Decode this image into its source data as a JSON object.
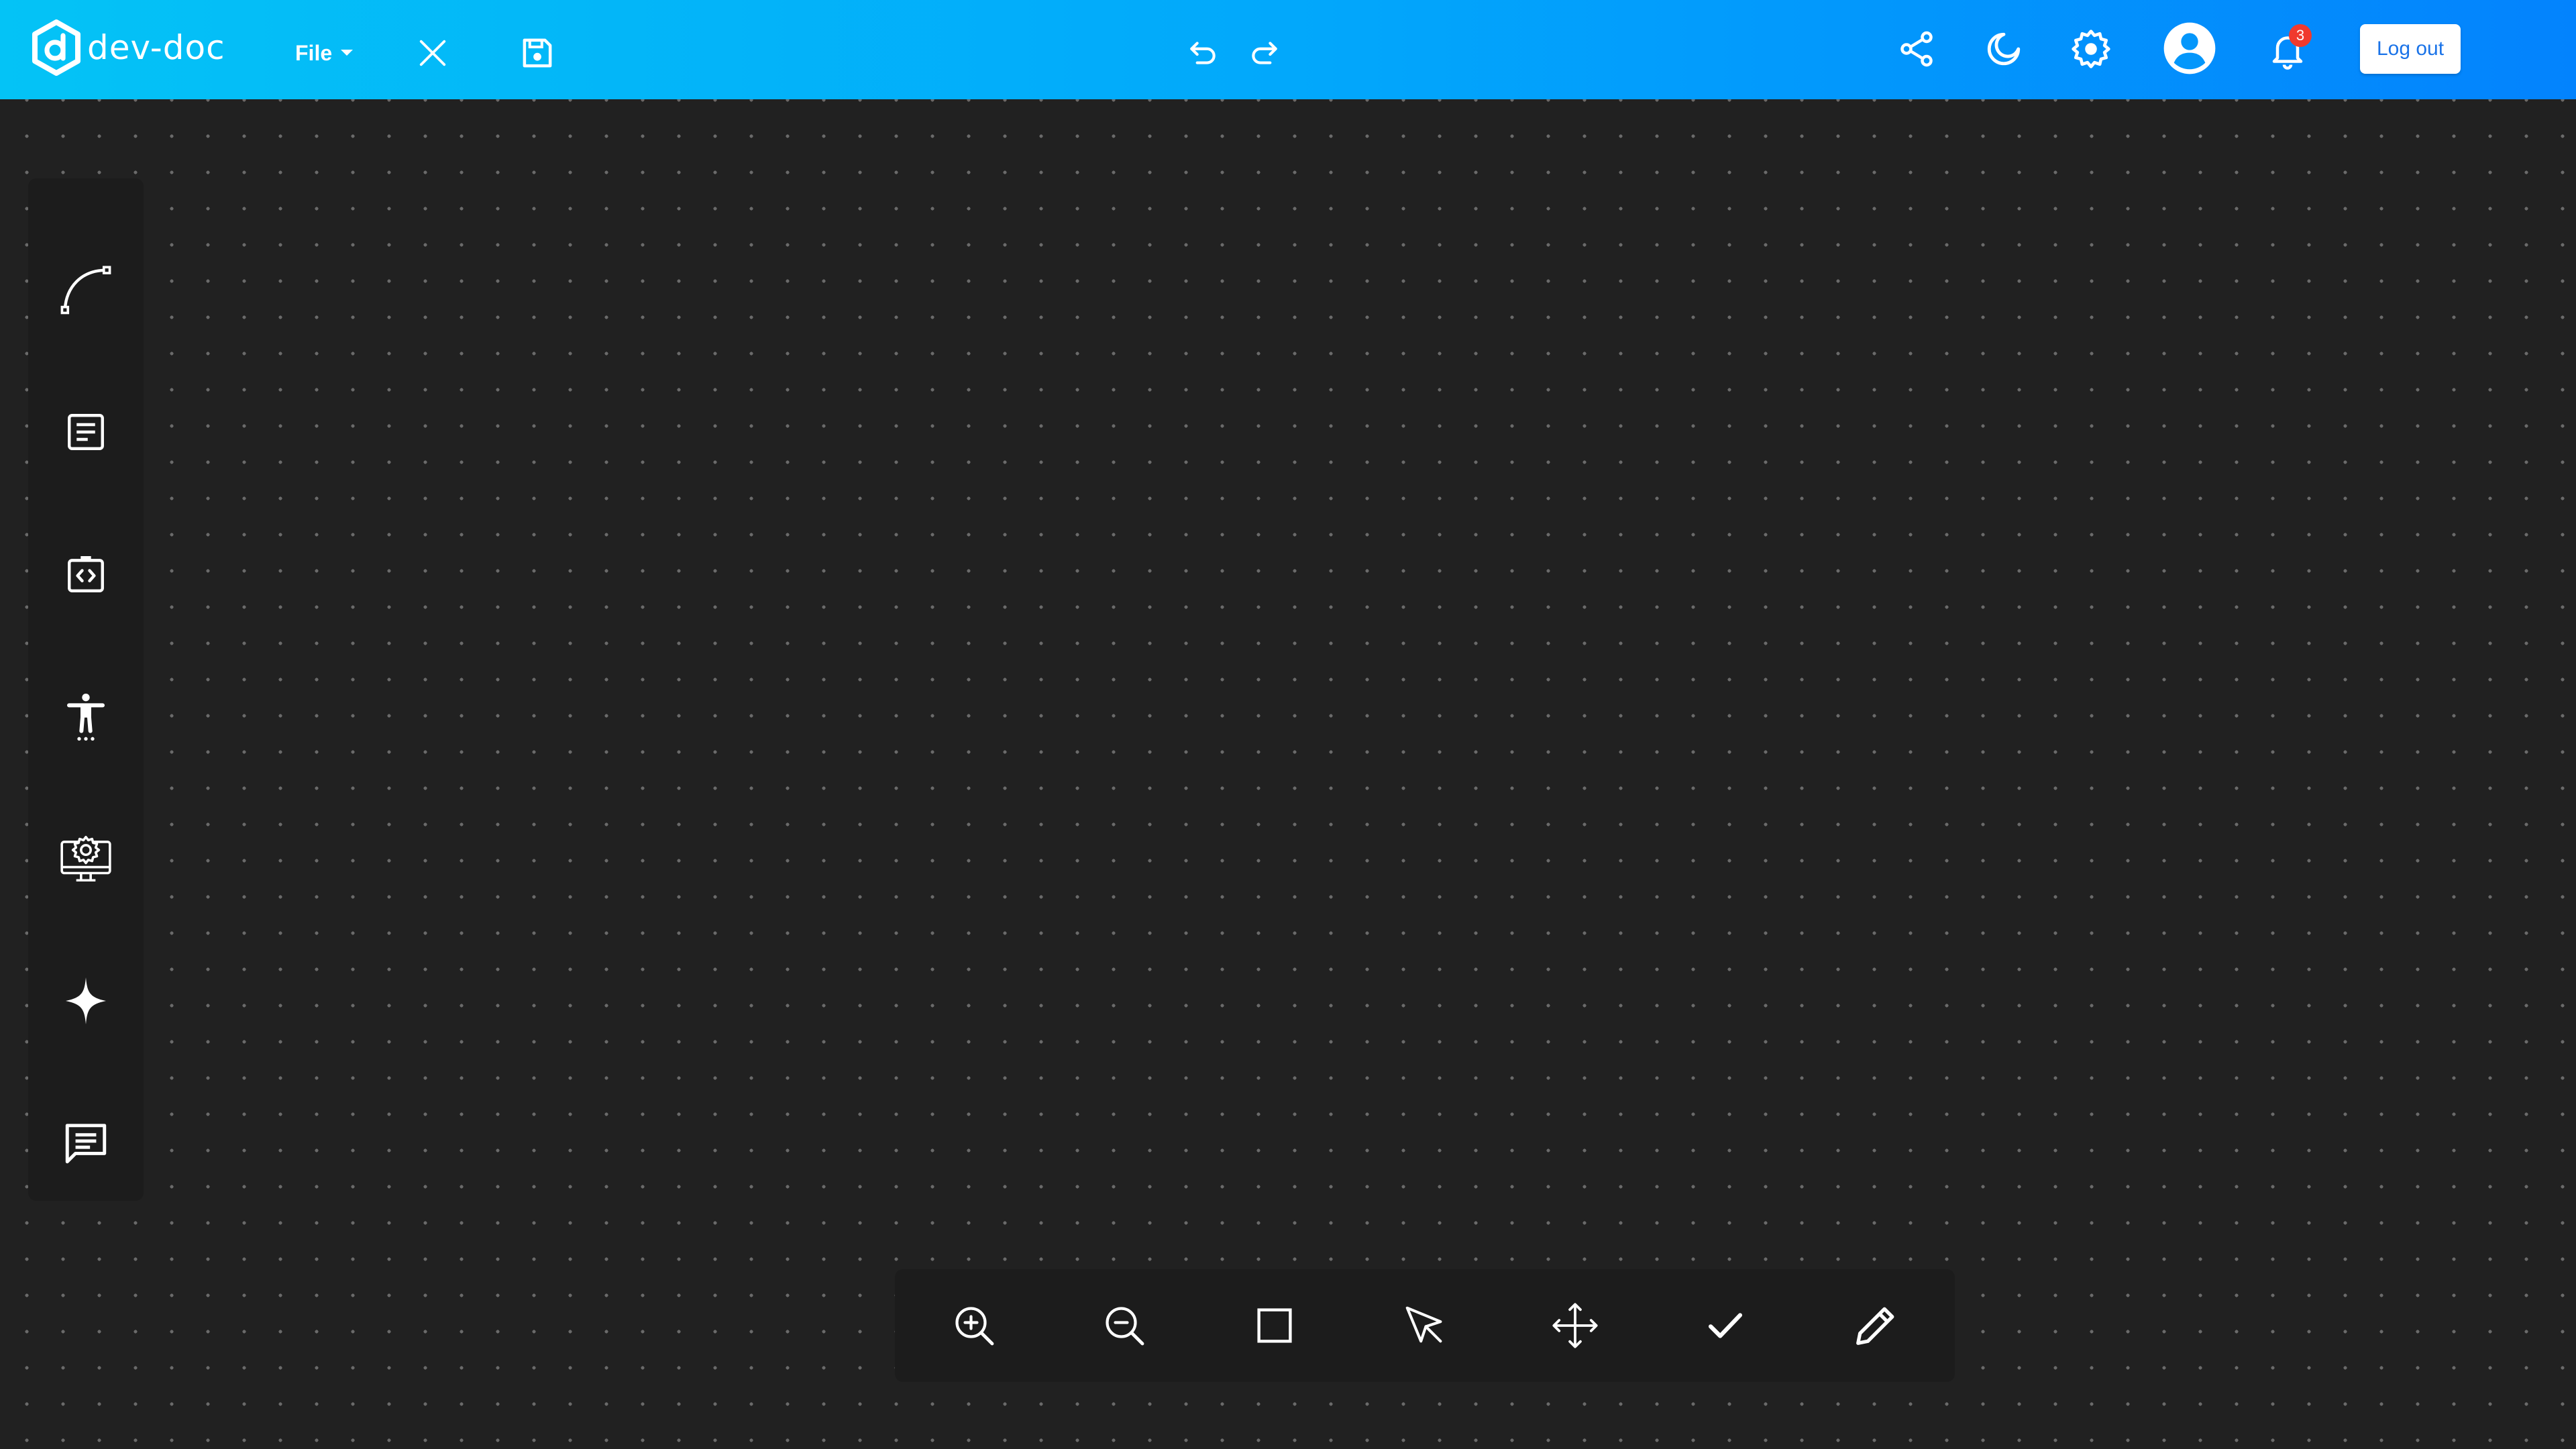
{
  "app": {
    "name": "dev-doc",
    "logo_icon": "hexagon-d-logo"
  },
  "header": {
    "file_menu_label": "File",
    "icons": {
      "close": "close-icon",
      "save": "save-icon",
      "undo": "undo-icon",
      "redo": "redo-icon",
      "share": "share-icon",
      "theme": "moon-icon",
      "settings": "gear-icon",
      "account": "account-circle-icon",
      "notifications": "bell-icon"
    },
    "notification_count": "3",
    "logout_label": "Log out"
  },
  "left_toolbar": {
    "tools": [
      {
        "name": "curve-tool",
        "icon": "bezier-curve-icon"
      },
      {
        "name": "document-tool",
        "icon": "document-lines-icon"
      },
      {
        "name": "code-block-tool",
        "icon": "code-clipboard-icon"
      },
      {
        "name": "accessibility-tool",
        "icon": "accessibility-icon"
      },
      {
        "name": "monitor-settings-tool",
        "icon": "monitor-gear-icon"
      },
      {
        "name": "sparkle-tool",
        "icon": "sparkle-star-icon"
      },
      {
        "name": "comment-tool",
        "icon": "chat-lines-icon"
      }
    ]
  },
  "bottom_toolbar": {
    "tools": [
      {
        "name": "zoom-in",
        "icon": "zoom-in-icon"
      },
      {
        "name": "zoom-out",
        "icon": "zoom-out-icon"
      },
      {
        "name": "rectangle",
        "icon": "square-icon"
      },
      {
        "name": "select",
        "icon": "cursor-arrow-icon"
      },
      {
        "name": "move",
        "icon": "move-arrows-icon"
      },
      {
        "name": "confirm",
        "icon": "check-icon"
      },
      {
        "name": "pencil",
        "icon": "pencil-icon"
      }
    ]
  },
  "colors": {
    "header_gradient_start": "#04c3f6",
    "header_gradient_end": "#0383fd",
    "canvas_background": "#212121",
    "toolbar_background": "#1c1c1c",
    "badge": "#f03a2e",
    "logout_text": "#1a73e8"
  }
}
